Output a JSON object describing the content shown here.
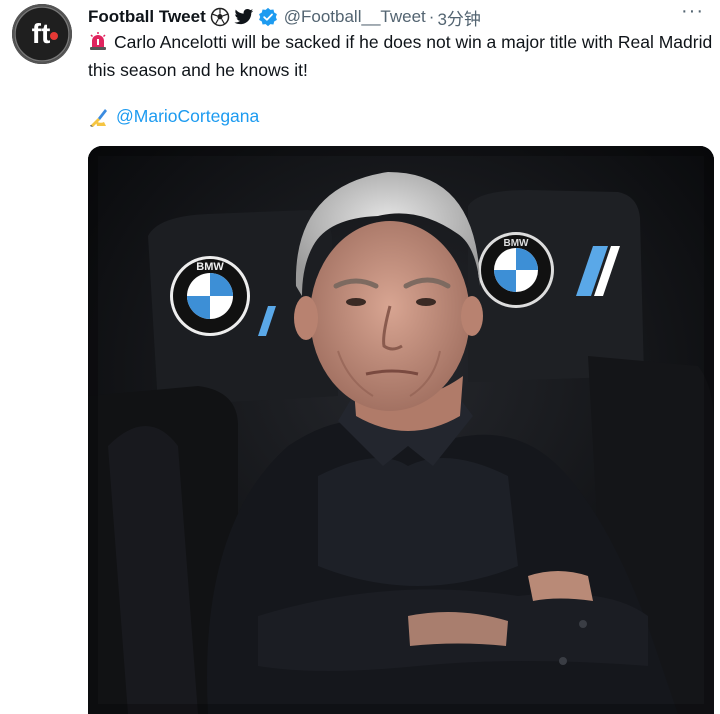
{
  "tweet": {
    "avatar": {
      "text": "ft",
      "icon": "football-tweet-logo"
    },
    "author_name": "Football Tweet",
    "handle": "@Football__Tweet",
    "separator": "·",
    "timestamp": "3分钟",
    "more_label": "···",
    "text": "Carlo Ancelotti will be sacked if he does not win a major title with Real Madrid this season and he knows it!",
    "credit_mention": "@MarioCortegana",
    "icons": [
      "soccer-ball-icon",
      "twitter-bird-icon",
      "verified-badge-icon",
      "siren-icon",
      "writing-hand-icon",
      "more-icon"
    ],
    "colors": {
      "link": "#1d9bf0",
      "verified": "#1d9bf0",
      "secondary_text": "#536471",
      "siren": "#e0245e"
    }
  },
  "media": {
    "description_icon": "photo-ancelotti-bench",
    "seat_logo_text": "BMW"
  }
}
